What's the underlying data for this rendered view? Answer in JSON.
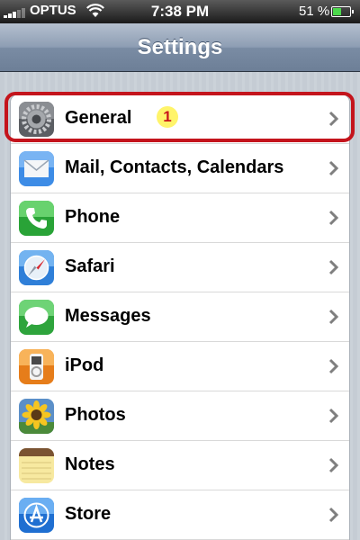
{
  "status_bar": {
    "carrier": "OPTUS",
    "time": "7:38 PM",
    "battery": "51 %",
    "battery_level": 0.51
  },
  "nav": {
    "title": "Settings"
  },
  "rows": [
    {
      "label": "General",
      "icon": "gear-icon",
      "badge": "1"
    },
    {
      "label": "Mail, Contacts, Calendars",
      "icon": "mail-icon"
    },
    {
      "label": "Phone",
      "icon": "phone-icon"
    },
    {
      "label": "Safari",
      "icon": "safari-compass-icon"
    },
    {
      "label": "Messages",
      "icon": "messages-bubble-icon"
    },
    {
      "label": "iPod",
      "icon": "ipod-icon"
    },
    {
      "label": "Photos",
      "icon": "photos-sunflower-icon"
    },
    {
      "label": "Notes",
      "icon": "notes-pad-icon"
    },
    {
      "label": "Store",
      "icon": "app-store-icon"
    }
  ],
  "colors": {
    "highlight": "#c4141c",
    "badge_bg": "#fff46a",
    "badge_text": "#c8161b"
  }
}
